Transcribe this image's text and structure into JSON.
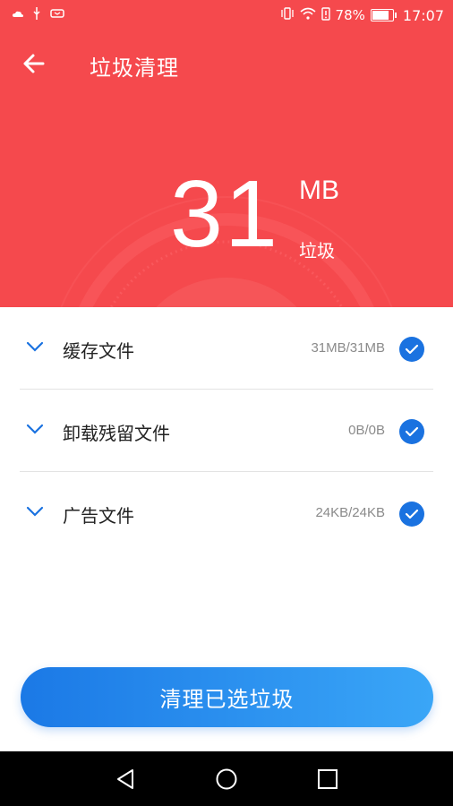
{
  "status_bar": {
    "battery_percent": "78%",
    "time": "17:07",
    "icons": [
      "cloud-icon",
      "usb-icon",
      "notification-icon",
      "vibrate-icon",
      "wifi-icon",
      "battery-alert-icon",
      "battery-icon"
    ]
  },
  "header": {
    "title": "垃圾清理",
    "back_icon": "arrow-left-icon",
    "size_value": "31",
    "size_unit": "MB",
    "size_label": "垃圾",
    "background_color": "#f5494d"
  },
  "items": [
    {
      "label": "缓存文件",
      "amount": "31MB/31MB",
      "checked": true
    },
    {
      "label": "卸载残留文件",
      "amount": "0B/0B",
      "checked": true
    },
    {
      "label": "广告文件",
      "amount": "24KB/24KB",
      "checked": true
    }
  ],
  "action": {
    "label": "清理已选垃圾",
    "colors": [
      "#1b79e6",
      "#3aa6f7"
    ]
  },
  "nav": {
    "buttons": [
      "back-triangle-icon",
      "home-circle-icon",
      "recents-square-icon"
    ]
  },
  "colors": {
    "accent": "#1a72e0",
    "header": "#f5494d"
  }
}
